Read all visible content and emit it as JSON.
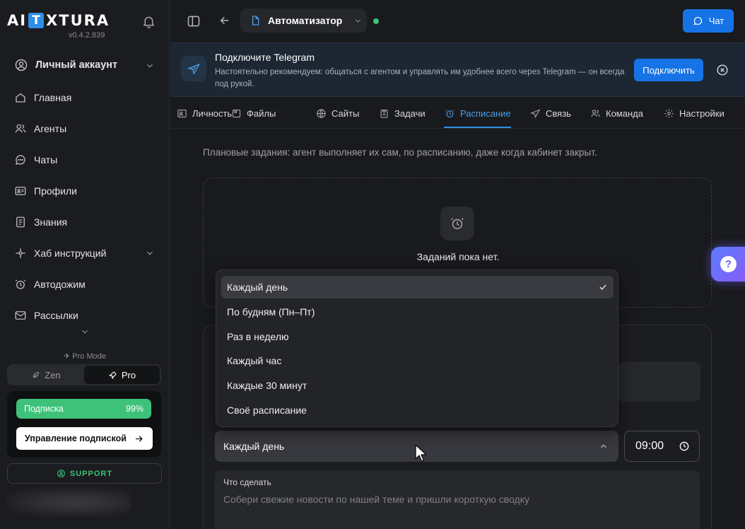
{
  "app": {
    "logo_left": "AI",
    "logo_box": "T",
    "logo_right": "XTURA",
    "version": "v0.4.2.839"
  },
  "sidebar": {
    "account_label": "Личный аккаунт",
    "items": [
      {
        "label": "Главная",
        "icon": "home-icon"
      },
      {
        "label": "Агенты",
        "icon": "users-icon"
      },
      {
        "label": "Чаты",
        "icon": "chat-icon"
      },
      {
        "label": "Профили",
        "icon": "id-card-icon"
      },
      {
        "label": "Знания",
        "icon": "document-icon"
      },
      {
        "label": "Хаб инструкций",
        "icon": "hub-icon"
      },
      {
        "label": "Автодожим",
        "icon": "alarm-icon"
      },
      {
        "label": "Рассылки",
        "icon": "mail-icon"
      }
    ],
    "pro_mode_label": "Pro Mode",
    "mode_zen": "Zen",
    "mode_pro": "Pro",
    "subscription_label": "Подписка",
    "subscription_percent": "99%",
    "manage_subscription": "Управление подпиской",
    "support": "SUPPORT"
  },
  "topbar": {
    "agent_name": "Автоматизатор",
    "chat_button": "Чат",
    "agent_status": "online"
  },
  "banner": {
    "title": "Подключите Telegram",
    "text": "Настоятельно рекомендуем: общаться с агентом и управлять им удобнее всего через Telegram — он всегда под рукой.",
    "connect_button": "Подключить"
  },
  "tabs": [
    {
      "label": "Личность",
      "icon": "persona-icon"
    },
    {
      "label": "Файлы",
      "icon": "folder-icon"
    },
    {
      "label": "Сайты",
      "icon": "globe-icon"
    },
    {
      "label": "Задачи",
      "icon": "clipboard-icon"
    },
    {
      "label": "Расписание",
      "icon": "alarm-clock-icon",
      "active": true
    },
    {
      "label": "Связь",
      "icon": "send-icon"
    },
    {
      "label": "Команда",
      "icon": "team-icon"
    },
    {
      "label": "Настройки",
      "icon": "gear-icon"
    }
  ],
  "schedule": {
    "description": "Плановые задания: агент выполняет их сам, по расписанию, даже когда кабинет закрыт.",
    "empty_text": "Заданий пока нет.",
    "frequency_value": "Каждый день",
    "frequency_options": [
      "Каждый день",
      "По будням (Пн–Пт)",
      "Раз в неделю",
      "Каждый час",
      "Каждые 30 минут",
      "Своё расписание"
    ],
    "time_value": "09:00",
    "task_label": "Что сделать",
    "task_placeholder": "Собери свежие новости по нашей теме и пришли короткую сводку"
  },
  "help": {
    "label": "?"
  },
  "colors": {
    "accent": "#1673e6",
    "success": "#3ec27a",
    "background": "#191a1d",
    "banner": "#1c2733"
  }
}
